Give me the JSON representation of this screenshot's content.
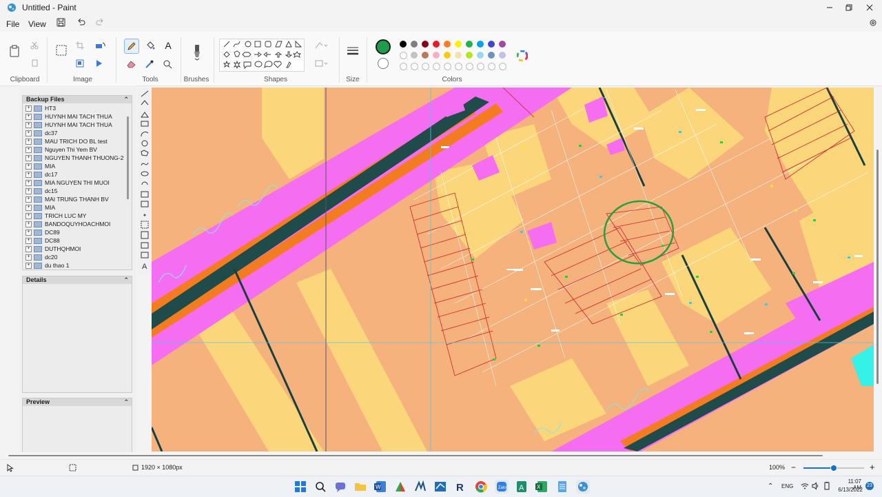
{
  "window": {
    "title": "Untitled - Paint"
  },
  "menu": {
    "file": "File",
    "view": "View"
  },
  "ribbon": {
    "groups": {
      "clipboard": "Clipboard",
      "image": "Image",
      "tools": "Tools",
      "brushes": "Brushes",
      "shapes": "Shapes",
      "size": "Size",
      "colors": "Colors"
    },
    "text_tool": "A",
    "color1": "#1e9b4b",
    "color2": "#ffffff",
    "palette": [
      "#000000",
      "#7f7f7f",
      "#880015",
      "#ed1c24",
      "#ff7f27",
      "#fff200",
      "#22b14c",
      "#00a2e8",
      "#3f48cc",
      "#a349a4",
      "#ffffff",
      "#c3c3c3",
      "#b97a57",
      "#ffaec9",
      "#ffc90e",
      "#efe4b0",
      "#b5e61d",
      "#99d9ea",
      "#7092be",
      "#c8bfe7"
    ]
  },
  "left_panel": {
    "backup_title": "Backup Files",
    "items": [
      "HT3",
      "HUYNH MAI TACH THUA",
      "HUYNH MAI TACH THUA",
      "dc37",
      "MAU TRICH DO BL test",
      "Nguyen Thi Yem BV",
      "NGUYEN THANH THUONG-2",
      "MIA",
      "dc17",
      "MIA NGUYEN THI MUOI",
      "dc15",
      "MAI TRUNG THANH BV",
      "MIA",
      "TRICH LUC MY",
      "BANDOQUYHOACHMOI",
      "DC89",
      "DC88",
      "DUTHQHMOI",
      "dc20",
      "du thao 1"
    ],
    "details_title": "Details",
    "preview_title": "Preview"
  },
  "status": {
    "canvas_size": "1920 × 1080px",
    "zoom": "100%",
    "zoom_level": 0.5
  },
  "taskbar": {
    "lang": "ENG",
    "time": "11:07 AM",
    "date": "6/13/2022",
    "badge": "23"
  }
}
